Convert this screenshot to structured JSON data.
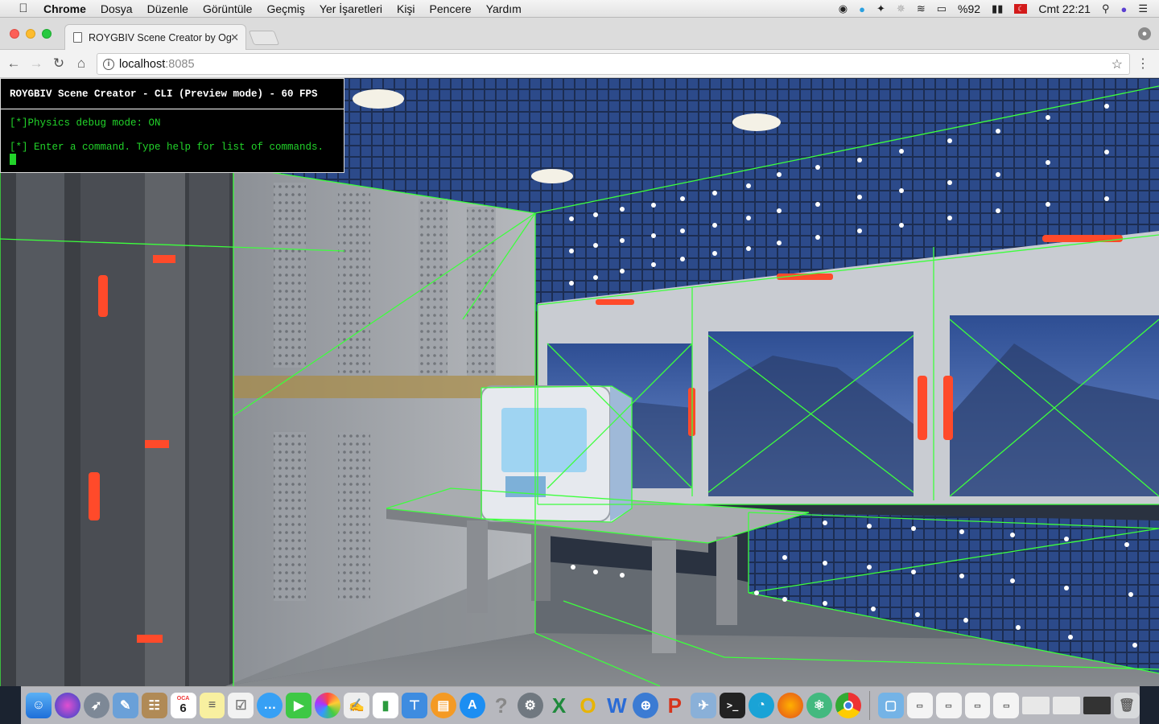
{
  "menubar": {
    "app_name": "Chrome",
    "items": [
      "Dosya",
      "Düzenle",
      "Görüntüle",
      "Geçmiş",
      "Yer İşaretleri",
      "Kişi",
      "Pencere",
      "Yardım"
    ],
    "battery": "%92",
    "clock": "Cmt 22:21"
  },
  "browser": {
    "tab_title": "ROYGBIV Scene Creator by Og",
    "url_host": "localhost",
    "url_port": ":8085"
  },
  "cli": {
    "header": "ROYGBIV Scene Creator - CLI (Preview mode) - 60 FPS",
    "line1": "[*]Physics debug mode: ON",
    "line2": "[*] Enter a command. Type help for list of commands."
  },
  "dock": {
    "calendar_month": "OCA",
    "calendar_day": "6",
    "icons": [
      "finder-icon",
      "siri-icon",
      "launchpad-icon",
      "preview-icon",
      "contacts-icon",
      "calendar-icon",
      "notes-icon",
      "reminders-icon",
      "messages-icon",
      "facetime-icon",
      "photos-icon",
      "textedit-icon",
      "numbers-icon",
      "keynote-icon",
      "books-icon",
      "app-store-icon",
      "help-icon",
      "system-preferences-icon",
      "excel-icon",
      "outlook-icon",
      "word-icon",
      "vpn-icon",
      "powerpoint-icon",
      "migration-icon",
      "terminal-icon",
      "activity-icon",
      "firefox-icon",
      "atom-icon",
      "chrome-icon",
      "downloads-folder-icon",
      "tga-file-icon-1",
      "tga-file-icon-2",
      "tga-file-icon-3",
      "tga-file-icon-4",
      "window-thumb-1",
      "window-thumb-node",
      "terminal-thumb",
      "trash-icon"
    ]
  },
  "colors": {
    "cli_text": "#22d32a",
    "physics_debug": "#3dff3d",
    "light_red": "#ff4a2a"
  }
}
